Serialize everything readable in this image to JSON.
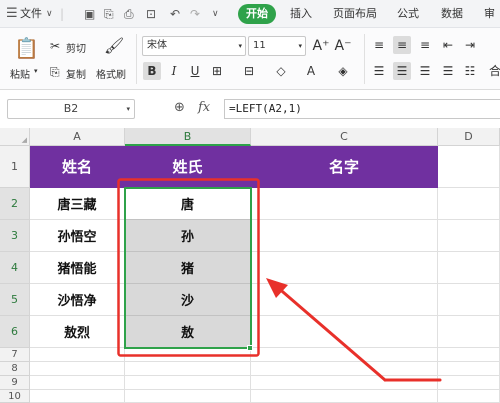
{
  "menubar": {
    "file_label": "文件",
    "tabs": [
      "开始",
      "插入",
      "页面布局",
      "公式",
      "数据",
      "审"
    ]
  },
  "ribbon": {
    "paste": "粘贴",
    "cut": "剪切",
    "copy": "复制",
    "format_painter": "格式刷",
    "font_name": "宋体",
    "font_size": "11"
  },
  "formula_bar": {
    "name_box": "B2",
    "formula": "=LEFT(A2,1)"
  },
  "sheet": {
    "column_headers": [
      "A",
      "B",
      "C",
      "D"
    ],
    "selected_column": "B",
    "row_numbers": [
      "1",
      "2",
      "3",
      "4",
      "5",
      "6",
      "7",
      "8",
      "9",
      "10"
    ],
    "header_row": [
      "姓名",
      "姓氏",
      "名字"
    ],
    "header_fill_color": "#7030a0",
    "rows": [
      {
        "name": "唐三藏",
        "surname": "唐"
      },
      {
        "name": "孙悟空",
        "surname": "孙"
      },
      {
        "name": "猪悟能",
        "surname": "猪"
      },
      {
        "name": "沙悟净",
        "surname": "沙"
      },
      {
        "name": "敖烈",
        "surname": "敖"
      }
    ]
  },
  "annotation": {
    "highlight_color": "#e8302a",
    "selection_color": "#2fa24a"
  }
}
